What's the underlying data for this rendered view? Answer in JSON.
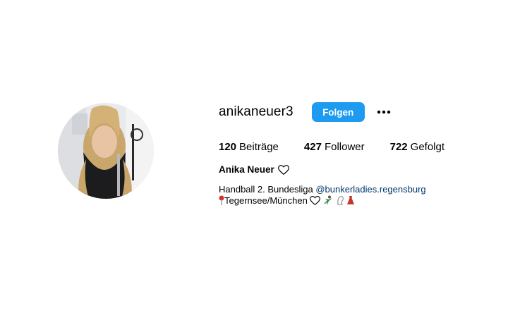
{
  "profile": {
    "username": "anikaneuer3",
    "follow_label": "Folgen",
    "more_icon": "more-options-icon",
    "stats": [
      {
        "count": "120",
        "label": "Beiträge"
      },
      {
        "count": "427",
        "label": "Follower"
      },
      {
        "count": "722",
        "label": "Gefolgt"
      }
    ],
    "full_name": "Anika Neuer",
    "name_icon": "heart-outline-icon",
    "bio": {
      "line1_text": "Handball 2. Bundesliga",
      "line1_mention": "@bunkerladies.regensburg",
      "line2_text": "Tegernsee/München",
      "line2_icons": [
        "pin-icon",
        "heart-outline-icon",
        "dancer-icon",
        "ghost-icon",
        "dress-icon"
      ]
    }
  },
  "colors": {
    "follow_button": "#1d9bf0",
    "mention": "#00376b",
    "text": "#000000"
  }
}
